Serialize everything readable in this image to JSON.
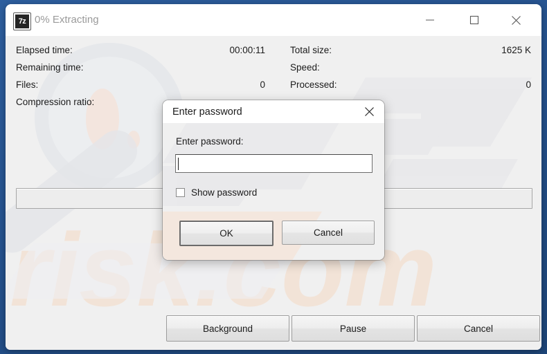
{
  "window": {
    "title": "0% Extracting",
    "icon": "sevenzip-icon",
    "icon_text": "7z",
    "controls": {
      "minimize": "minimize-icon",
      "maximize": "maximize-icon",
      "close": "close-icon"
    },
    "frame_color": "#2a5a96",
    "titlebar_color": "#ffffff",
    "title_text_color": "#9a9a9a"
  },
  "stats": {
    "left_column": [
      {
        "label": "Elapsed time:",
        "value": "00:00:11"
      },
      {
        "label": "Remaining time:",
        "value": ""
      },
      {
        "label": "Files:",
        "value": "0"
      },
      {
        "label": "Compression ratio:",
        "value": ""
      }
    ],
    "right_column": [
      {
        "label": "Total size:",
        "value": "1625 K"
      },
      {
        "label": "Speed:",
        "value": ""
      },
      {
        "label": "Processed:",
        "value": "0"
      },
      {
        "label": "",
        "value": ""
      }
    ]
  },
  "progress": {
    "percent": 0,
    "percent_label": "0%"
  },
  "buttons": {
    "background": "Background",
    "pause": "Pause",
    "cancel": "Cancel"
  },
  "dialog": {
    "title": "Enter password",
    "close_icon": "close-icon",
    "password_label": "Enter password:",
    "password_value": "",
    "password_placeholder": "",
    "show_password_label": "Show password",
    "show_password_checked": false,
    "ok_label": "OK",
    "cancel_label": "Cancel",
    "default_button": "OK"
  },
  "watermark": {
    "text": "risk.com",
    "color": "#f2e3d8"
  }
}
